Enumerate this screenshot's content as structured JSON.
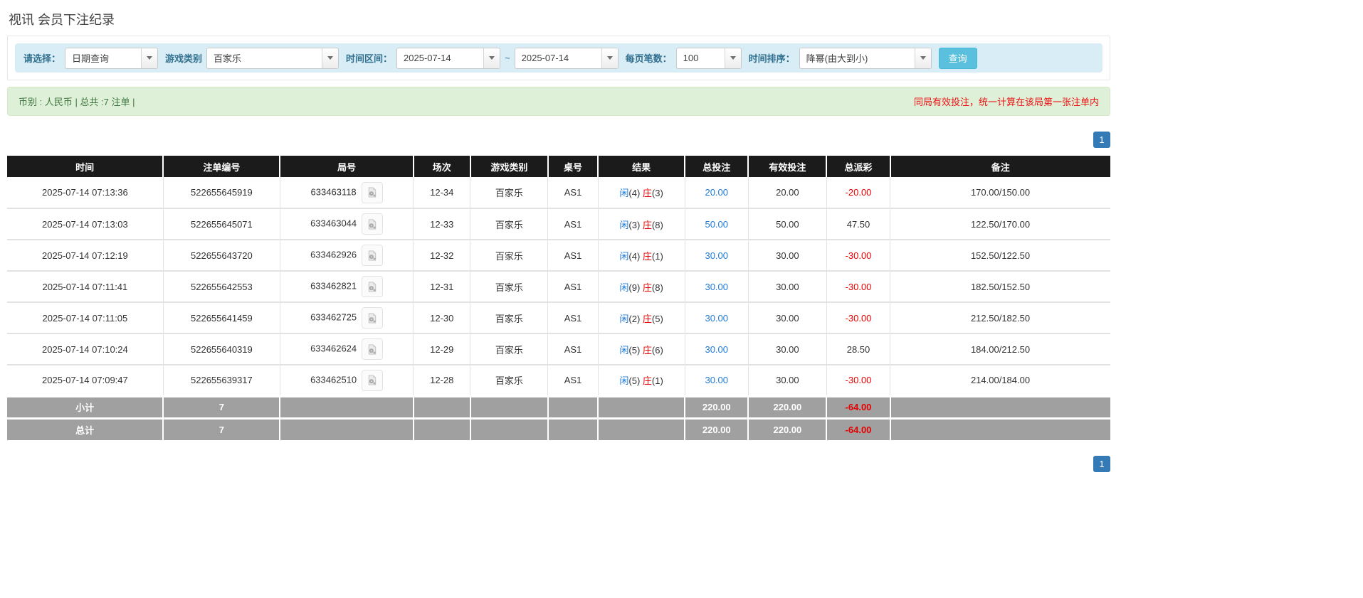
{
  "page": {
    "title": "视讯 会员下注纪录"
  },
  "filters": {
    "select_label": "请选择：",
    "select_value": "日期查询",
    "game_label": "游戏类别",
    "game_value": "百家乐",
    "range_label": "时间区间：",
    "date_from": "2025-07-14",
    "tilde": "~",
    "date_to": "2025-07-14",
    "per_page_label": "每页笔数：",
    "per_page_value": "100",
    "sort_label": "时间排序：",
    "sort_value": "降幂(由大到小)",
    "search_button": "查询"
  },
  "summary_bar": {
    "left": "币别 : 人民币 | 总共 :7 注单 |",
    "right": "同局有效投注，统一计算在该局第一张注单内"
  },
  "pagination": {
    "page": "1"
  },
  "table": {
    "headers": [
      "时间",
      "注单编号",
      "局号",
      "场次",
      "游戏类别",
      "桌号",
      "结果",
      "总投注",
      "有效投注",
      "总派彩",
      "备注"
    ],
    "rows": [
      {
        "time": "2025-07-14 07:13:36",
        "bet_id": "522655645919",
        "round_id": "633463118",
        "session": "12-34",
        "game": "百家乐",
        "table_no": "AS1",
        "player_label": "闲",
        "player_num": "(4)",
        "banker_label": "庄",
        "banker_num": "(3)",
        "total_bet": "20.00",
        "valid_bet": "20.00",
        "payout": "-20.00",
        "remark": "170.00/150.00"
      },
      {
        "time": "2025-07-14 07:13:03",
        "bet_id": "522655645071",
        "round_id": "633463044",
        "session": "12-33",
        "game": "百家乐",
        "table_no": "AS1",
        "player_label": "闲",
        "player_num": "(3)",
        "banker_label": "庄",
        "banker_num": "(8)",
        "total_bet": "50.00",
        "valid_bet": "50.00",
        "payout": "47.50",
        "remark": "122.50/170.00"
      },
      {
        "time": "2025-07-14 07:12:19",
        "bet_id": "522655643720",
        "round_id": "633462926",
        "session": "12-32",
        "game": "百家乐",
        "table_no": "AS1",
        "player_label": "闲",
        "player_num": "(4)",
        "banker_label": "庄",
        "banker_num": "(1)",
        "total_bet": "30.00",
        "valid_bet": "30.00",
        "payout": "-30.00",
        "remark": "152.50/122.50"
      },
      {
        "time": "2025-07-14 07:11:41",
        "bet_id": "522655642553",
        "round_id": "633462821",
        "session": "12-31",
        "game": "百家乐",
        "table_no": "AS1",
        "player_label": "闲",
        "player_num": "(9)",
        "banker_label": "庄",
        "banker_num": "(8)",
        "total_bet": "30.00",
        "valid_bet": "30.00",
        "payout": "-30.00",
        "remark": "182.50/152.50"
      },
      {
        "time": "2025-07-14 07:11:05",
        "bet_id": "522655641459",
        "round_id": "633462725",
        "session": "12-30",
        "game": "百家乐",
        "table_no": "AS1",
        "player_label": "闲",
        "player_num": "(2)",
        "banker_label": "庄",
        "banker_num": "(5)",
        "total_bet": "30.00",
        "valid_bet": "30.00",
        "payout": "-30.00",
        "remark": "212.50/182.50"
      },
      {
        "time": "2025-07-14 07:10:24",
        "bet_id": "522655640319",
        "round_id": "633462624",
        "session": "12-29",
        "game": "百家乐",
        "table_no": "AS1",
        "player_label": "闲",
        "player_num": "(5)",
        "banker_label": "庄",
        "banker_num": "(6)",
        "total_bet": "30.00",
        "valid_bet": "30.00",
        "payout": "28.50",
        "remark": "184.00/212.50"
      },
      {
        "time": "2025-07-14 07:09:47",
        "bet_id": "522655639317",
        "round_id": "633462510",
        "session": "12-28",
        "game": "百家乐",
        "table_no": "AS1",
        "player_label": "闲",
        "player_num": "(5)",
        "banker_label": "庄",
        "banker_num": "(1)",
        "total_bet": "30.00",
        "valid_bet": "30.00",
        "payout": "-30.00",
        "remark": "214.00/184.00"
      }
    ],
    "subtotal": {
      "label": "小计",
      "count": "7",
      "total_bet": "220.00",
      "valid_bet": "220.00",
      "payout": "-64.00"
    },
    "total": {
      "label": "总计",
      "count": "7",
      "total_bet": "220.00",
      "valid_bet": "220.00",
      "payout": "-64.00"
    }
  },
  "icons": {
    "video_replay": "video-file-icon",
    "dropdown": "chevron-down-icon"
  },
  "colors": {
    "filter_bar_bg": "#d9edf7",
    "filter_label": "#31708f",
    "search_button": "#5bc0de",
    "alert_bg": "#dff0d8",
    "alert_text": "#3c763d",
    "note_red": "#ee1111",
    "header_bg": "#1b1b1b",
    "summary_row_bg": "#a0a0a0",
    "amount_blue": "#1e7bd9",
    "negative_red": "#e60000",
    "pagination_blue": "#337ab7"
  }
}
